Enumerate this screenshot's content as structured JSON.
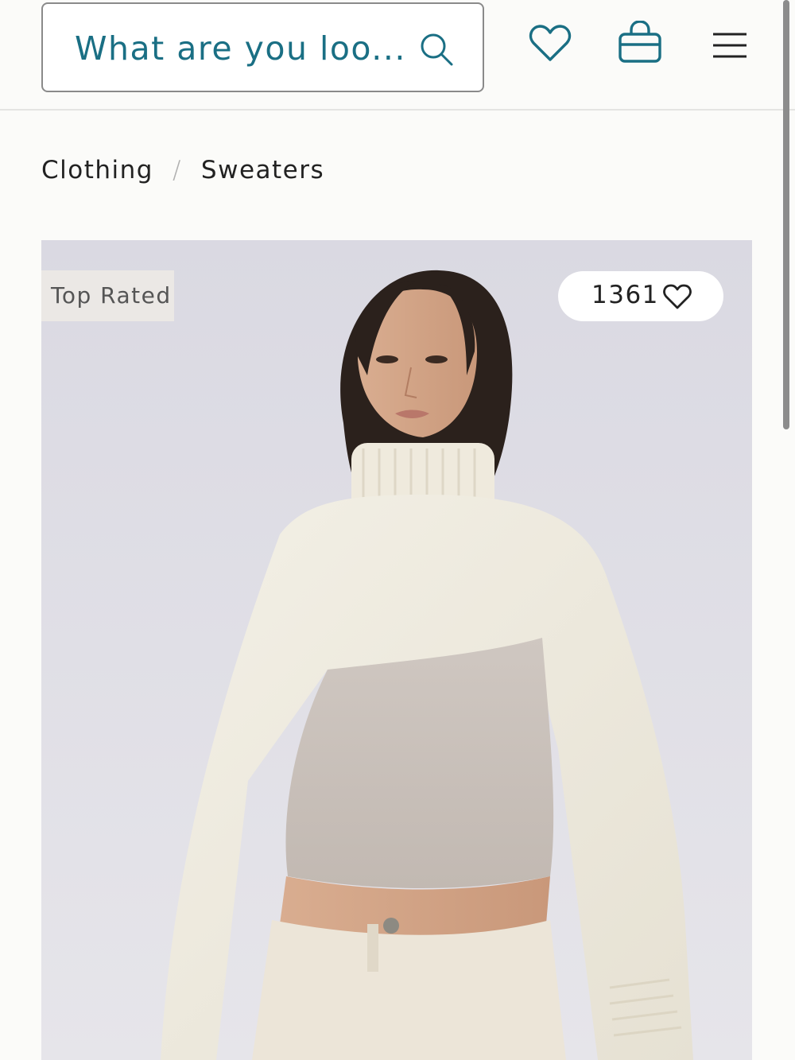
{
  "header": {
    "search_placeholder": "What are you loo...",
    "icons": [
      "search-icon",
      "heart-icon",
      "shopping-bag-icon",
      "menu-icon"
    ],
    "accent_color": "#1a6f84"
  },
  "breadcrumb": {
    "items": [
      "Clothing",
      "Sweaters"
    ],
    "separator": "/"
  },
  "product": {
    "badge": "Top Rated",
    "likes": "1361",
    "image": "woman-in-cream-turtleneck-shrug-sweater"
  }
}
